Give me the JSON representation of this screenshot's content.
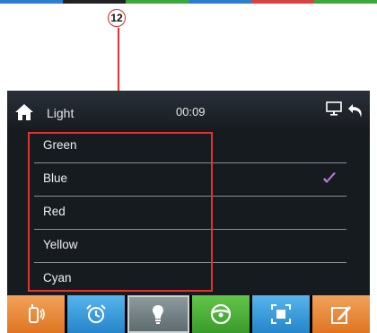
{
  "callout": {
    "number": "12"
  },
  "header": {
    "title": "Light",
    "time": "00:09"
  },
  "list": {
    "items": [
      {
        "label": "Green",
        "selected": false
      },
      {
        "label": "Blue",
        "selected": true
      },
      {
        "label": "Red",
        "selected": false
      },
      {
        "label": "Yellow",
        "selected": false
      },
      {
        "label": "Cyan",
        "selected": false
      }
    ]
  },
  "bottom_bar": {
    "buttons": [
      {
        "icon": "intercom-icon",
        "color": "#df7522"
      },
      {
        "icon": "alarm-clock-icon",
        "color": "#2585c9"
      },
      {
        "icon": "light-bulb-icon",
        "color": "#5e6b6f"
      },
      {
        "icon": "steering-wheel-icon",
        "color": "#3a9a2b"
      },
      {
        "icon": "screen-icon",
        "color": "#2585c9"
      },
      {
        "icon": "edit-icon",
        "color": "#df7522"
      }
    ]
  },
  "colors": {
    "highlight": "#e13333",
    "check": "#b57ad6",
    "screen_bg": "#161b20"
  }
}
